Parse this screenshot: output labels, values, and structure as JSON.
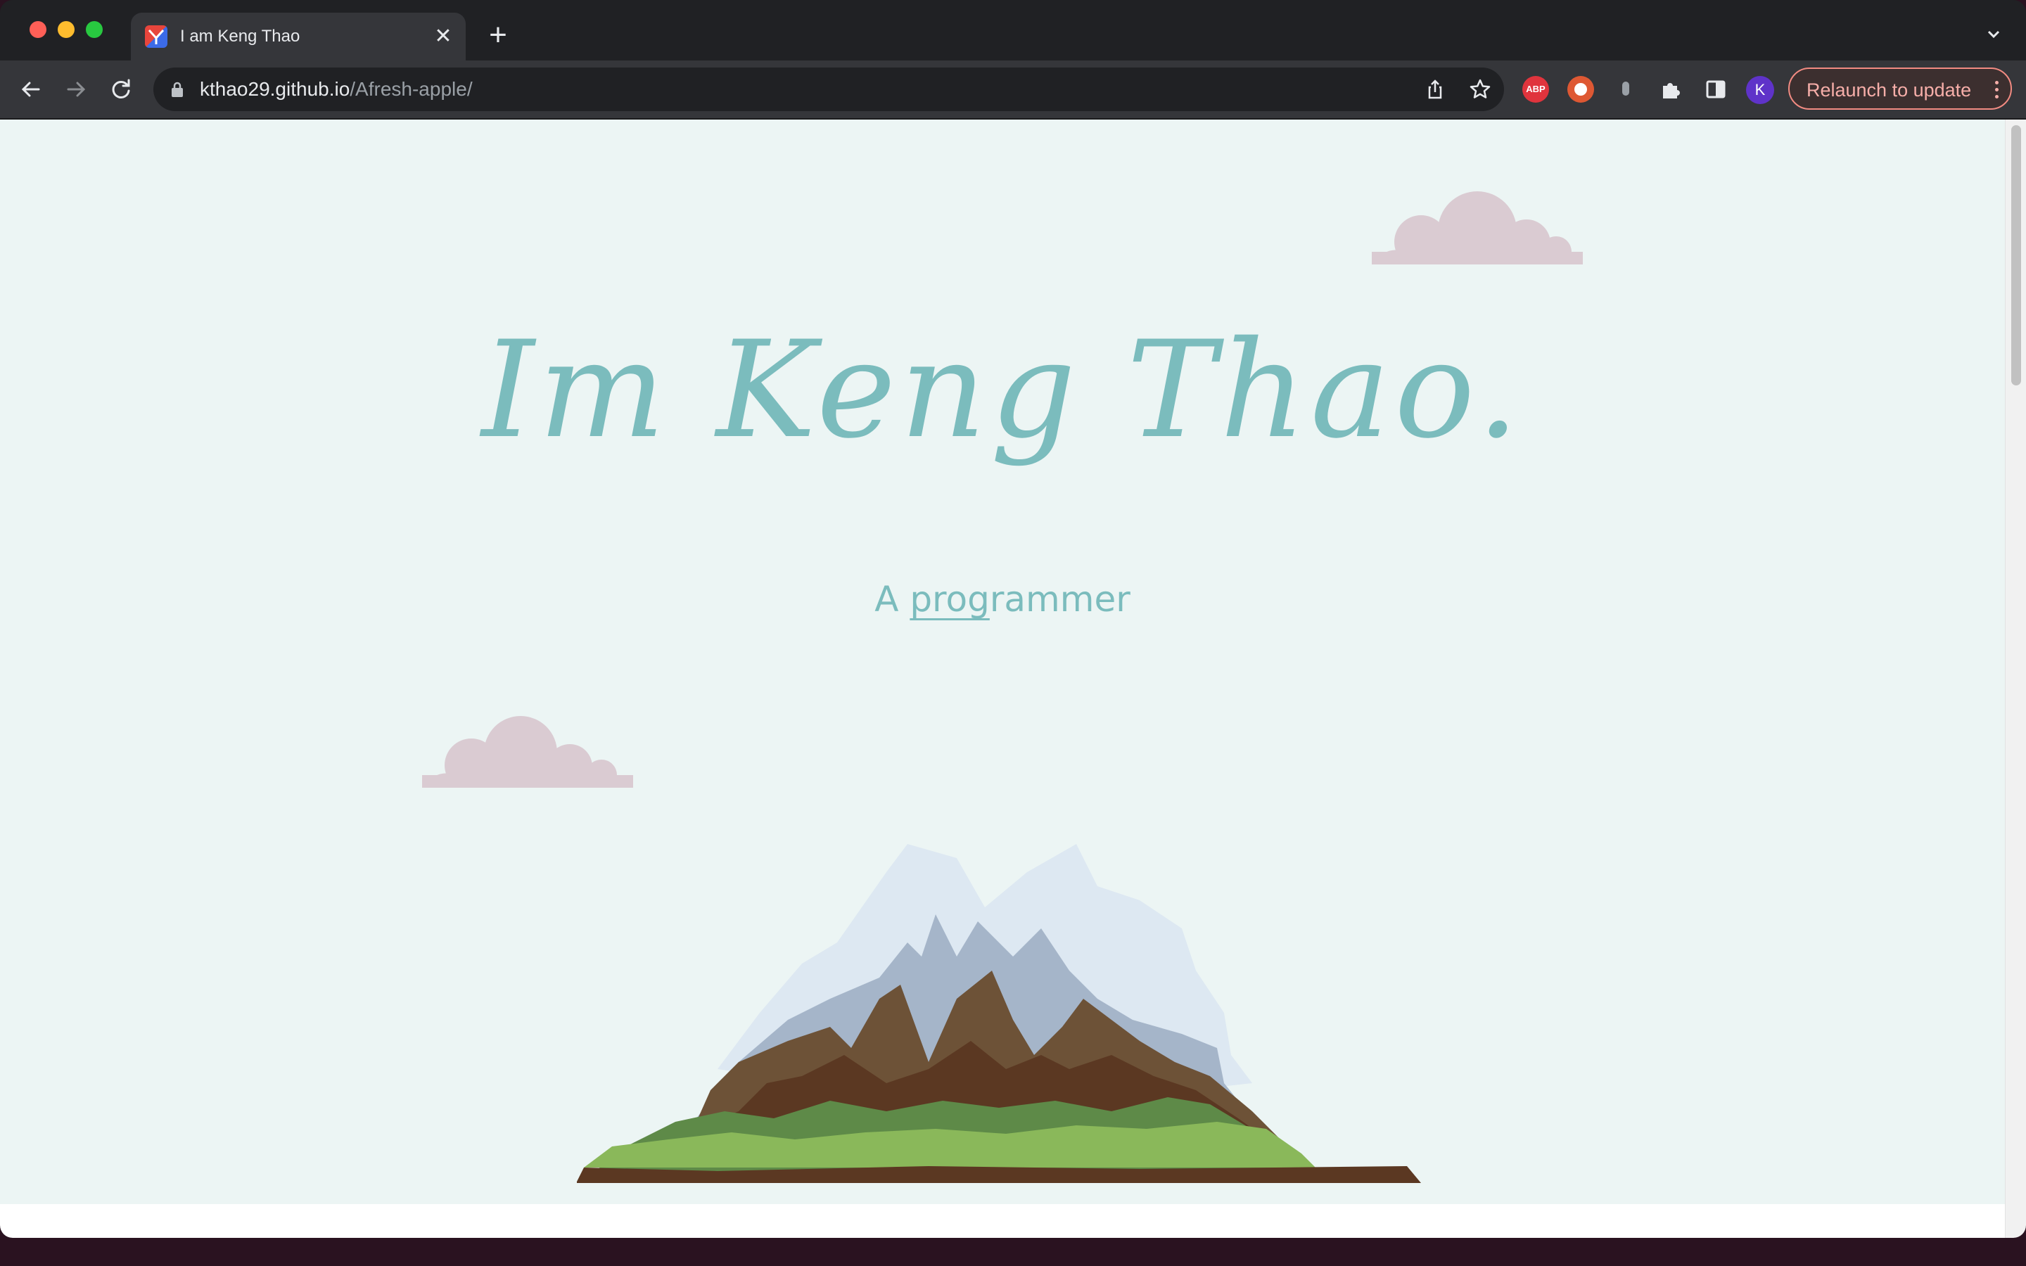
{
  "browser": {
    "tab": {
      "title": "I am Keng Thao",
      "close_glyph": "✕"
    },
    "new_tab_glyph": "+",
    "address": {
      "host": "kthao29.github.io",
      "path": "/Afresh-apple/"
    },
    "extensions": {
      "abp_label": "ABP"
    },
    "profile_initial": "K",
    "relaunch_label": "Relaunch to update",
    "icons": [
      "back-icon",
      "forward-icon",
      "reload-icon",
      "lock-icon",
      "share-icon",
      "star-icon",
      "puzzle-icon",
      "sidebar-icon",
      "tab-search-icon"
    ]
  },
  "page": {
    "hero_title": "Im Keng Thao.",
    "subtitle_prefix": "A ",
    "subtitle_typed": "prog",
    "subtitle_rest": "rammer",
    "colors": {
      "background": "#ecf5f4",
      "accent": "#7bbcbd",
      "cloud": "#dacbd2"
    }
  }
}
